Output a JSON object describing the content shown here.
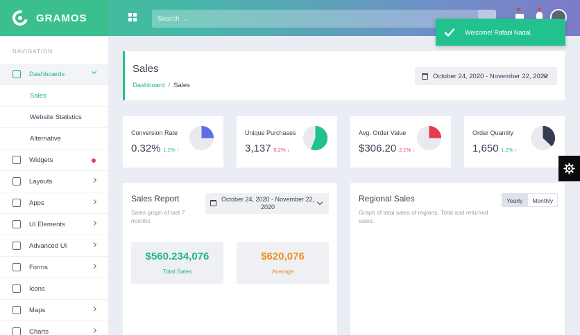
{
  "brand": {
    "name": "GRAMOS"
  },
  "search": {
    "placeholder": "Search ..."
  },
  "toast": {
    "message": "Welcome! Rafael Nadal."
  },
  "sidebar": {
    "heading": "NAVIGATION",
    "items": [
      {
        "label": "Dashboards",
        "icon": "home-icon",
        "active": true
      },
      {
        "label": "Widgets",
        "icon": "paint-bucket-icon",
        "badge_dot": true
      },
      {
        "label": "Layouts",
        "icon": "layout-icon"
      },
      {
        "label": "Apps",
        "icon": "rocket-icon"
      },
      {
        "label": "UI Elements",
        "icon": "copy-icon"
      },
      {
        "label": "Advanced UI",
        "icon": "brush-icon"
      },
      {
        "label": "Forms",
        "icon": "clipboard-icon"
      },
      {
        "label": "Icons",
        "icon": "crown-icon"
      },
      {
        "label": "Maps",
        "icon": "map-icon"
      },
      {
        "label": "Charts",
        "icon": "pie-chart-icon"
      }
    ],
    "sub_items": [
      "Sales",
      "Website Statistics",
      "Alternative"
    ]
  },
  "page": {
    "title": "Sales",
    "breadcrumb_link": "Dashboard",
    "breadcrumb_sep": "/",
    "breadcrumb_current": "Sales",
    "date_range": "October 24, 2020 - November 22, 2020"
  },
  "stats": [
    {
      "label": "Conversion Rate",
      "value": "0.32%",
      "change": "1.2%",
      "direction": "up",
      "arrow": "↑",
      "pie_fraction": 0.25,
      "color": "#5b6ee8"
    },
    {
      "label": "Unique Purchases",
      "value": "3,137",
      "change": "0.2%",
      "direction": "down",
      "arrow": "↓",
      "pie_fraction": 0.56,
      "color": "#21c28e"
    },
    {
      "label": "Avg. Order Value",
      "value": "$306.20",
      "change": "2.1%",
      "direction": "down",
      "arrow": "↓",
      "pie_fraction": 0.25,
      "color": "#e8394f"
    },
    {
      "label": "Order Quantity",
      "value": "1,650",
      "change": "1.2%",
      "direction": "up",
      "arrow": "↑",
      "pie_fraction": 0.37,
      "color": "#353b50"
    }
  ],
  "sales_report": {
    "title": "Sales Report",
    "subtitle": "Sales graph of last 7 months",
    "date_range": "October 24, 2020 - November 22, 2020",
    "total_value": "$560.234,076",
    "total_label": "Total Sales",
    "average_value": "$620,076",
    "average_label": "Average"
  },
  "regional": {
    "title": "Regional Sales",
    "subtitle": "Graph of total sales of regions. Total and returned sales.",
    "toggle_yearly": "Yearly",
    "toggle_monthly": "Monthly"
  },
  "colors": {
    "accent": "#21c28e",
    "danger": "#e8394f",
    "warning": "#ef8d1f"
  }
}
